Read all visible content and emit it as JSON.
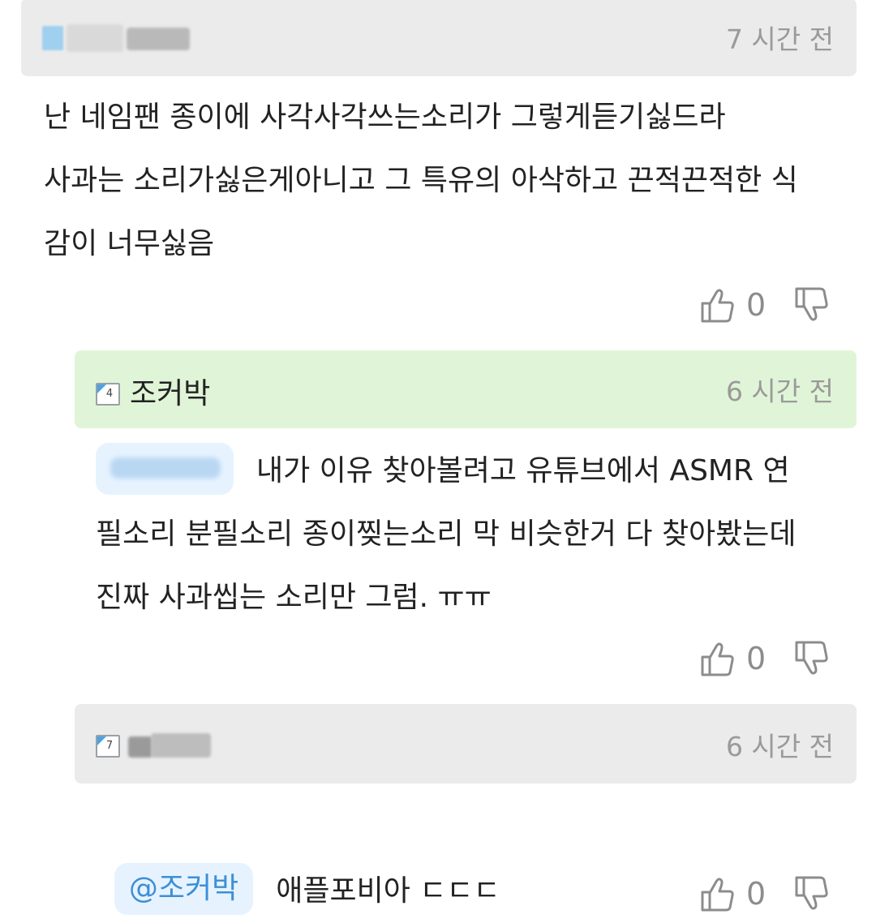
{
  "comments": [
    {
      "level": "",
      "nickname": "",
      "time": "7 시간 전",
      "mention": "",
      "text": "난 네임팬 종이에 사각사각쓰는소리가 그렇게듣기싫드라\n사과는 소리가싫은게아니고 그 특유의 아삭하고 끈적끈적한 식\n감이 너무싫음",
      "likes": "0"
    },
    {
      "level": "4",
      "nickname": "조커박",
      "time": "6 시간 전",
      "mention": "",
      "text": "내가 이유 찾아볼려고 유튜브에서 ASMR 연\n필소리 분필소리 종이찢는소리 막 비슷한거 다 찾아봤는데\n진짜 사과씹는 소리만 그럼. ㅠㅠ",
      "likes": "0"
    },
    {
      "level": "7",
      "nickname": "",
      "time": "6 시간 전",
      "mention": "@조커박",
      "text": "애플포비아 ㄷㄷㄷ",
      "likes": "0"
    }
  ],
  "icons": {
    "like": "thumbs-up-icon",
    "dislike": "thumbs-down-icon",
    "level": "level-badge-icon"
  },
  "colors": {
    "header_gray": "#ebebeb",
    "header_green": "#e0f5d8",
    "mention_bg": "#e6f3ff",
    "mention_text": "#3d8fd6",
    "muted": "#9a9a9a"
  }
}
